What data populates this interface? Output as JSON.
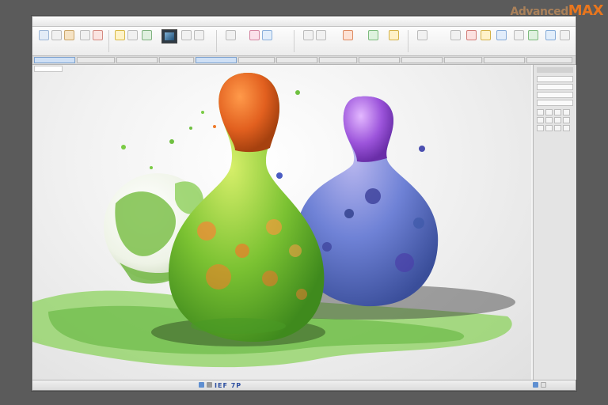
{
  "app": {
    "watermark_prefix": "Advanced",
    "watermark_suffix": "MAX"
  },
  "status": {
    "text": "IEF 7P"
  },
  "colors": {
    "ribbon_accent": "#2b6fd1",
    "warning": "#e0322d",
    "ok": "#37a845",
    "highlight": "#f3c21a"
  },
  "icons": {
    "ribbon": [
      "paint-icon",
      "brush-icon",
      "color-icon",
      "palette-icon",
      "filter-icon",
      "preview-icon",
      "layers-icon",
      "select-icon",
      "crop-icon",
      "render-icon",
      "texture-icon",
      "light-icon",
      "camera-icon",
      "material-icon",
      "grid-icon",
      "export-icon"
    ],
    "status": [
      "zoom-icon",
      "navigate-icon"
    ]
  }
}
